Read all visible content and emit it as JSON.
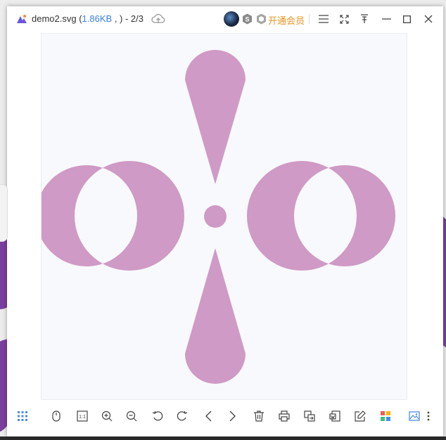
{
  "window": {
    "filename": "demo2.svg",
    "open_paren": " (",
    "file_size": "1.86KB",
    "size_suffix": " , ) - 2/3",
    "vip_label": "开通会员"
  },
  "colors": {
    "accent": "#3a7ee0",
    "vip": "#e89422",
    "shape_fill": "#cf9ac5",
    "canvas_bg": "#f8f9fd"
  },
  "title_buttons": [
    "menu-icon",
    "fullscreen-icon",
    "pin-icon",
    "minimize-icon",
    "maximize-icon",
    "close-icon"
  ],
  "toolbar": [
    "grid-view-icon",
    "mouse-icon",
    "actual-size-icon",
    "zoom-in-icon",
    "zoom-out-icon",
    "rotate-left-icon",
    "rotate-right-icon",
    "previous-icon",
    "next-icon",
    "delete-icon",
    "print-icon",
    "convert-icon",
    "export-icon",
    "edit-icon",
    "apps-icon",
    "image-icon",
    "more-icon"
  ]
}
